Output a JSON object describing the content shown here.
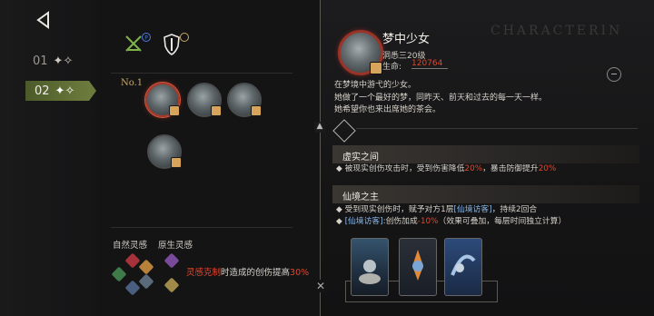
{
  "left_nav": {
    "back_icon": "back-arrow-icon",
    "pages": [
      {
        "num": "01",
        "icon": "sparkle-icon"
      },
      {
        "num": "02",
        "icon": "sparkle-icon",
        "active": true
      }
    ]
  },
  "bond": {
    "rank_label": "No.1",
    "natural_title": "自然灵感",
    "native_title": "原生灵感",
    "counter_prefix": "灵感克制",
    "counter_mid": "时造成的创伤提高",
    "counter_pct": "30%",
    "portraits": 4,
    "colors": {
      "red": "#e0462e",
      "green": "#6c7b3c",
      "gold": "#d6a45a"
    }
  },
  "character": {
    "name": "梦中少女",
    "level": "洞悉三20级",
    "hp_label": "生命:",
    "hp_value": "120764",
    "watermark": "CHARACTERIN"
  },
  "description": [
    "在梦境中游弋的少女。",
    "她做了一个最好的梦，同昨天、前天和过去的每一天一样。",
    "她希望你也来出席她的茶会。"
  ],
  "skills": [
    {
      "title": "虚实之间",
      "bullets": [
        {
          "prefix": "被现实创伤攻击时，受到伤害降低",
          "v1": "20%",
          "mid": "，暴击防御提升",
          "v2": "20%"
        }
      ]
    },
    {
      "title": "仙境之主",
      "bullets": [
        {
          "prefix": "受到现实创伤时，赋予对方1层",
          "link": "[仙境访客]",
          "suffix": "，持续2回合"
        },
        {
          "link": "[仙境访客]",
          "mid": ":创伤加成",
          "v1": "-10%",
          "suffix": "（效果可叠加，每层时间独立计算）"
        }
      ]
    }
  ],
  "cards": [
    "card-1",
    "card-2",
    "card-3"
  ]
}
